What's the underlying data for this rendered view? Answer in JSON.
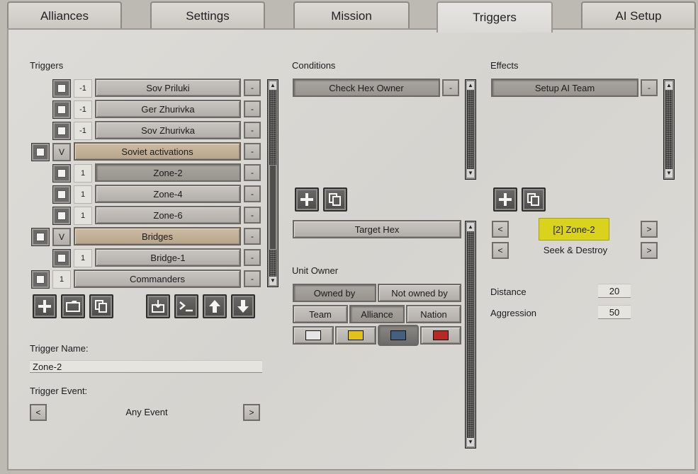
{
  "tabs": [
    "Alliances",
    "Settings",
    "Mission",
    "Triggers",
    "AI Setup"
  ],
  "triggers": {
    "title": "Triggers",
    "items": [
      {
        "num": "-1",
        "label": "Sov Priluki"
      },
      {
        "num": "-1",
        "label": "Ger Zhurivka"
      },
      {
        "num": "-1",
        "label": "Sov Zhurivka"
      },
      {
        "num": "V",
        "label": "Soviet activations"
      },
      {
        "num": "1",
        "label": "Zone-2"
      },
      {
        "num": "1",
        "label": "Zone-4"
      },
      {
        "num": "1",
        "label": "Zone-6"
      },
      {
        "num": "V",
        "label": "Bridges"
      },
      {
        "num": "1",
        "label": "Bridge-1"
      },
      {
        "num": "1",
        "label": "Commanders"
      }
    ],
    "minus": "-",
    "name_label": "Trigger Name:",
    "name_value": "Zone-2",
    "event_label": "Trigger Event:",
    "event_value": "Any Event",
    "prev": "<",
    "next": ">"
  },
  "conditions": {
    "title": "Conditions",
    "items": [
      "Check Hex Owner"
    ],
    "target_hex": "Target Hex",
    "unit_owner_label": "Unit Owner",
    "owned_by": "Owned by",
    "not_owned_by": "Not owned by",
    "team": "Team",
    "alliance": "Alliance",
    "nation": "Nation",
    "colors": [
      "#e6e6e6",
      "#e0c21a",
      "#44607e",
      "#b52a22"
    ]
  },
  "effects": {
    "title": "Effects",
    "items": [
      "Setup AI Team"
    ],
    "zone": "[2] Zone-2",
    "order": "Seek & Destroy",
    "distance_label": "Distance",
    "distance_value": "20",
    "aggression_label": "Aggression",
    "aggression_value": "50"
  },
  "accent": "#d9d31e"
}
